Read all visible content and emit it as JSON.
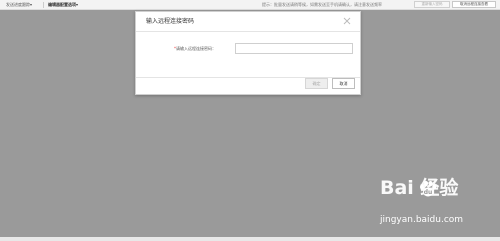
{
  "toolbar": {
    "menu_1": "发送进度跟踪▾",
    "menu_2": "编辑器配置选项▾",
    "notice": "提示：批量发送请稍等候，如需发送至手机请确认，请注意发送频率",
    "button_a": "重新输入密码",
    "button_b": "取消远程连接查看"
  },
  "dialog": {
    "title": "输入远程连接密码",
    "field_label": "请输入远程连接密码：",
    "field_required_mark": "*",
    "password_value": "",
    "password_placeholder": "",
    "ok_label": "确定",
    "cancel_label": "取消"
  },
  "watermark": {
    "logo_text": "Bai 经验",
    "url": "jingyan.baidu.com"
  },
  "colors": {
    "overlay": "#9a9a9a",
    "dialog_bg": "#ffffff",
    "required": "#e33333"
  }
}
